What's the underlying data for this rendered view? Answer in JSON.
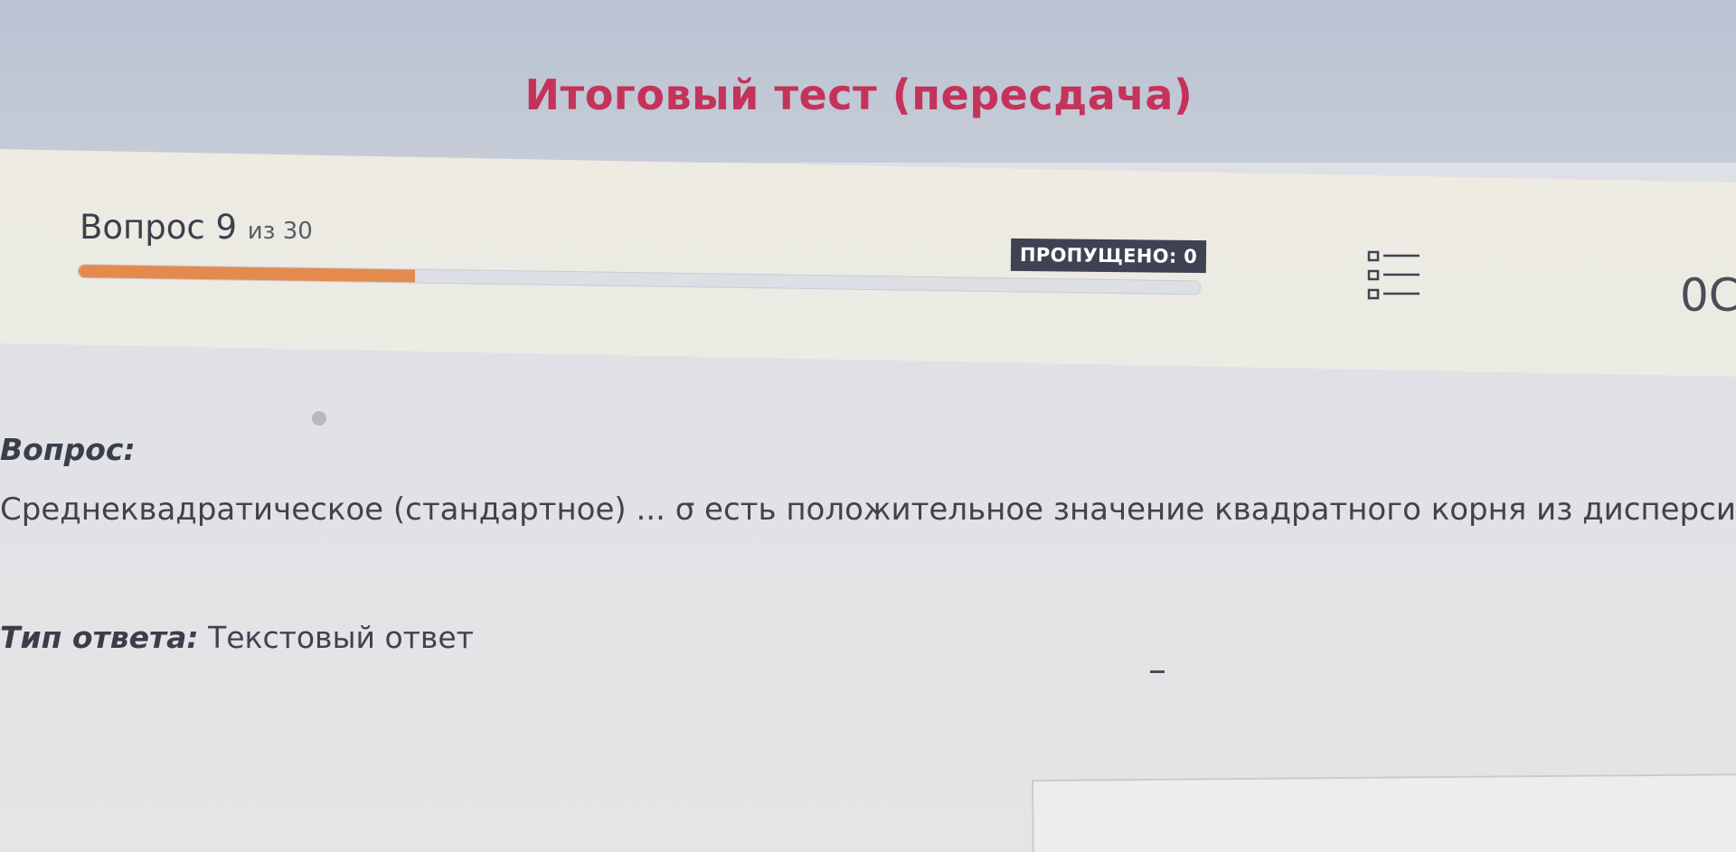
{
  "header": {
    "title": "Итоговый тест (пересдача)"
  },
  "progress": {
    "question_word": "Вопрос",
    "current": "9",
    "of_text": "из 30",
    "fraction_complete": 0.3,
    "skipped_label": "ПРОПУЩЕНО: 0",
    "list_icon": "question-list-icon",
    "timer_text": "0C"
  },
  "question": {
    "label": "Вопрос:",
    "text": "Среднеквадратическое (стандартное) ... σ есть положительное значение квадратного корня из дисперси",
    "answer_type_label": "Тип ответа:",
    "answer_type_value": "Текстовый ответ",
    "answer_value": ""
  },
  "colors": {
    "title": "#c4335a",
    "progress_fill": "#e58a4e",
    "badge_bg": "#3e4252"
  }
}
